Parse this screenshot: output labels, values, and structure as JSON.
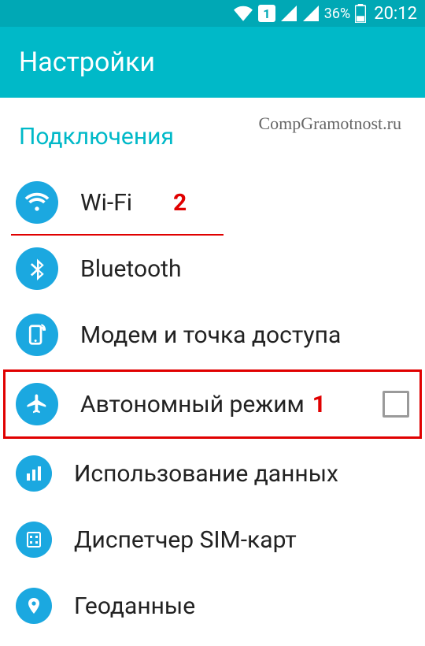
{
  "status": {
    "sim_indicator": "1",
    "battery_pct": "36%",
    "time": "20:12"
  },
  "header": {
    "title": "Настройки"
  },
  "watermark": "CompGramotnost.ru",
  "section": {
    "title": "Подключения"
  },
  "rows": {
    "wifi": {
      "label": "Wi-Fi",
      "annot": "2"
    },
    "bluetooth": {
      "label": "Bluetooth"
    },
    "tethering": {
      "label": "Модем и точка доступа"
    },
    "airplane": {
      "label": "Автономный режим",
      "annot": "1",
      "checked": false
    },
    "datausage": {
      "label": "Использование данных"
    },
    "sim": {
      "label": "Диспетчер SIM-карт"
    },
    "location": {
      "label": "Геоданные"
    }
  }
}
